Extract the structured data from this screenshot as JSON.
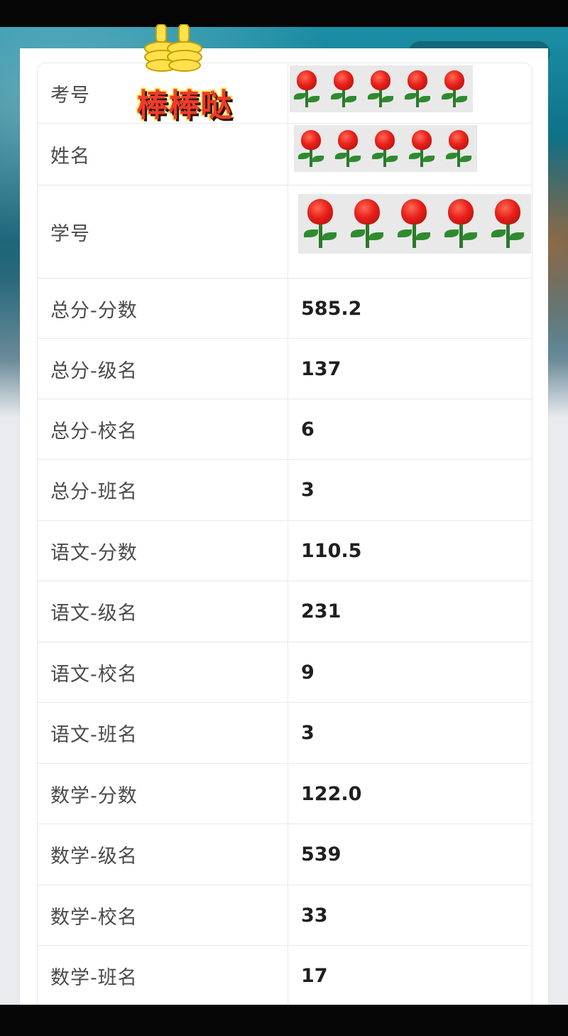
{
  "sticker": {
    "text": "棒棒哒",
    "icon": "thumbs-up-icon"
  },
  "rows": [
    {
      "label": "考号",
      "value": "",
      "rose_count": 5
    },
    {
      "label": "姓名",
      "value": "",
      "rose_count": 5
    },
    {
      "label": "学号",
      "value": "",
      "rose_count": 5
    },
    {
      "label": "总分-分数",
      "value": "585.2"
    },
    {
      "label": "总分-级名",
      "value": "137"
    },
    {
      "label": "总分-校名",
      "value": "6"
    },
    {
      "label": "总分-班名",
      "value": "3"
    },
    {
      "label": "语文-分数",
      "value": "110.5"
    },
    {
      "label": "语文-级名",
      "value": "231"
    },
    {
      "label": "语文-校名",
      "value": "9"
    },
    {
      "label": "语文-班名",
      "value": "3"
    },
    {
      "label": "数学-分数",
      "value": "122.0"
    },
    {
      "label": "数学-级名",
      "value": "539"
    },
    {
      "label": "数学-校名",
      "value": "33"
    },
    {
      "label": "数学-班名",
      "value": "17"
    }
  ]
}
